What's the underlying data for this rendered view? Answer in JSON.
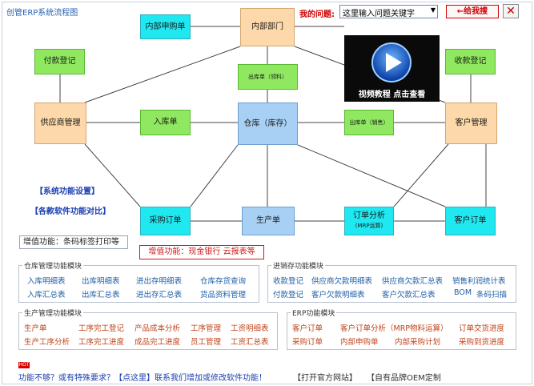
{
  "window": {
    "title": "创管ERP系统流程图"
  },
  "question": {
    "label": "我的问题:",
    "placeholder": "这里输入问题关键字",
    "help_button": "←给我搜",
    "close_symbol": "✕"
  },
  "nodes": {
    "internal_purchase": "内部申购单",
    "internal_dept": "内部部门",
    "payment_reg": "付款登记",
    "outbound_pick": "出库单（领料）",
    "receipt_reg": "收款登记",
    "supplier_mgmt": "供应商管理",
    "inbound": "入库单",
    "warehouse": "仓库（库存）",
    "outbound_sales": "出库单（销售）",
    "customer_mgmt": "客户管理",
    "purchase_order": "采购订单",
    "production": "生产单",
    "order_analysis_line1": "订单分析",
    "order_analysis_line2": "(MRP运算)",
    "customer_order": "客户订单"
  },
  "video": {
    "caption": "视频教程 点击查看"
  },
  "links": {
    "system_settings": "【系统功能设置】",
    "compare_editions": "【各款软件功能对比】"
  },
  "addons": {
    "barcode": "增值功能：条码标签打印等",
    "cash_bank": "增值功能：现金银行 云报表等"
  },
  "panels": {
    "warehouse": {
      "title": "仓库管理功能模块",
      "rows": [
        [
          "入库明细表",
          "出库明细表",
          "进出存明细表",
          "仓库存货查询"
        ],
        [
          "入库汇总表",
          "出库汇总表",
          "进出存汇总表",
          "货品资料管理"
        ]
      ]
    },
    "inv_sales": {
      "title": "进销存功能模块",
      "rows": [
        [
          "收款登记",
          "供应商欠款明细表",
          "供应商欠款汇总表",
          "销售利润统计表"
        ],
        [
          "付款登记",
          "客户欠款明细表",
          "客户欠款汇总表",
          "BOM",
          "条码扫描"
        ]
      ]
    },
    "production": {
      "title": "生产管理功能模块",
      "rows": [
        [
          "生产单",
          "工序完工登记",
          "产品成本分析",
          "工序管理",
          "工资明细表"
        ],
        [
          "生产工序分析",
          "工序完工进度",
          "成品完工进度",
          "员工管理",
          "工资汇总表"
        ]
      ]
    },
    "erp": {
      "title": "ERP功能模块",
      "rows": [
        [
          "客户订单",
          "客户订单分析（MRP物料运算）",
          "订单交货进度"
        ],
        [
          "采购订单",
          "内部申购单",
          "内部采购计划",
          "采购到货进度"
        ]
      ]
    }
  },
  "bottom": {
    "hot": "HOT",
    "custom_request": "功能不够？或有特殊要求？【点这里】联系我们增加或修改软件功能！",
    "open_site": "【打开官方网站】",
    "oem": "【自有品牌OEM定制"
  }
}
